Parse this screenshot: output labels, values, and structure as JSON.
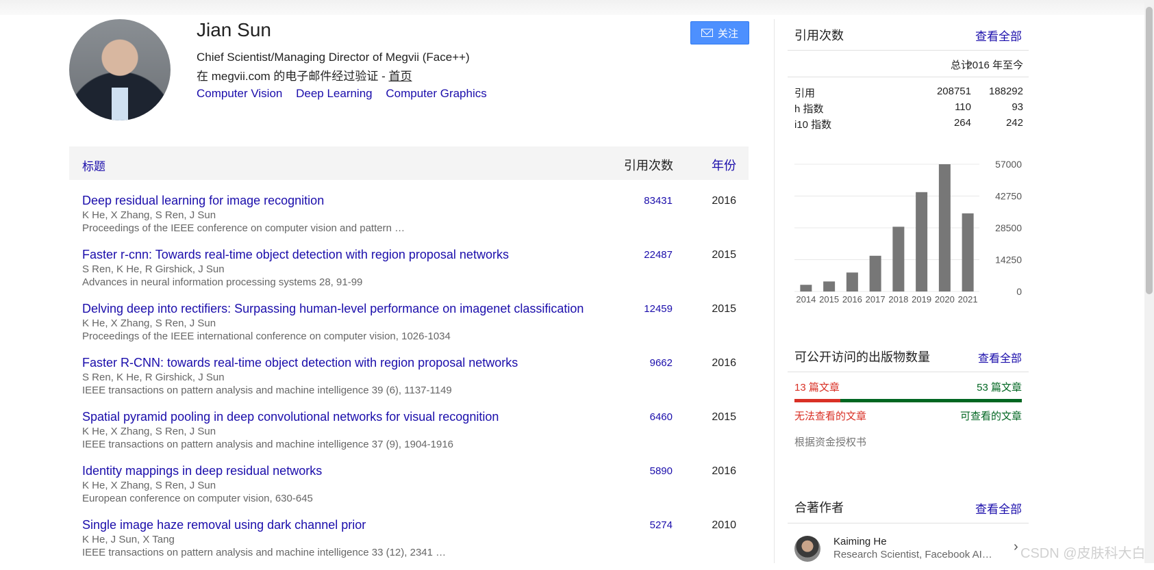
{
  "profile": {
    "name": "Jian Sun",
    "affiliation": "Chief Scientist/Managing Director of Megvii (Face++)",
    "verified_prefix": "在 megvii.com 的电子邮件经过验证 - ",
    "homepage_label": "首页",
    "interests": [
      "Computer Vision",
      "Deep Learning",
      "Computer Graphics"
    ],
    "follow_label": "关注"
  },
  "table": {
    "col_title": "标题",
    "col_cites": "引用次数",
    "col_year": "年份",
    "rows": [
      {
        "title": "Deep residual learning for image recognition",
        "authors": "K He, X Zhang, S Ren, J Sun",
        "venue": "Proceedings of the IEEE conference on computer vision and pattern …",
        "cites": "83431",
        "year": "2016"
      },
      {
        "title": "Faster r-cnn: Towards real-time object detection with region proposal networks",
        "authors": "S Ren, K He, R Girshick, J Sun",
        "venue": "Advances in neural information processing systems 28, 91-99",
        "cites": "22487",
        "year": "2015"
      },
      {
        "title": "Delving deep into rectifiers: Surpassing human-level performance on imagenet classification",
        "authors": "K He, X Zhang, S Ren, J Sun",
        "venue": "Proceedings of the IEEE international conference on computer vision, 1026-1034",
        "cites": "12459",
        "year": "2015"
      },
      {
        "title": "Faster R-CNN: towards real-time object detection with region proposal networks",
        "authors": "S Ren, K He, R Girshick, J Sun",
        "venue": "IEEE transactions on pattern analysis and machine intelligence 39 (6), 1137-1149",
        "cites": "9662",
        "year": "2016"
      },
      {
        "title": "Spatial pyramid pooling in deep convolutional networks for visual recognition",
        "authors": "K He, X Zhang, S Ren, J Sun",
        "venue": "IEEE transactions on pattern analysis and machine intelligence 37 (9), 1904-1916",
        "cites": "6460",
        "year": "2015"
      },
      {
        "title": "Identity mappings in deep residual networks",
        "authors": "K He, X Zhang, S Ren, J Sun",
        "venue": "European conference on computer vision, 630-645",
        "cites": "5890",
        "year": "2016"
      },
      {
        "title": "Single image haze removal using dark channel prior",
        "authors": "K He, J Sun, X Tang",
        "venue": "IEEE transactions on pattern analysis and machine intelligence 33 (12), 2341 …",
        "cites": "5274",
        "year": "2010"
      }
    ]
  },
  "citations": {
    "heading": "引用次数",
    "view_all": "查看全部",
    "col_total": "总计",
    "col_since": "2016 年至今",
    "rows": [
      {
        "label": "引用",
        "total": "208751",
        "since": "188292"
      },
      {
        "label": "h 指数",
        "total": "110",
        "since": "93"
      },
      {
        "label": "i10 指数",
        "total": "264",
        "since": "242"
      }
    ]
  },
  "chart_data": {
    "type": "bar",
    "categories": [
      "2014",
      "2015",
      "2016",
      "2017",
      "2018",
      "2019",
      "2020",
      "2021"
    ],
    "values": [
      3000,
      4500,
      8500,
      16000,
      29000,
      44500,
      57000,
      35000
    ],
    "yticks": [
      "57000",
      "42750",
      "28500",
      "14250",
      "0"
    ],
    "ylim": [
      0,
      57000
    ],
    "bar_color": "#777777"
  },
  "open_access": {
    "heading": "可公开访问的出版物数量",
    "view_all": "查看全部",
    "unavailable_count": "13 篇文章",
    "available_count": "53 篇文章",
    "unavailable_label": "无法查看的文章",
    "available_label": "可查看的文章",
    "mandate_label": "根据资金授权书",
    "unavailable_color": "#d93025",
    "available_color": "#006621"
  },
  "coauthors": {
    "heading": "合著作者",
    "view_all": "查看全部",
    "items": [
      {
        "name": "Kaiming He",
        "affiliation": "Research Scientist, Facebook AI…"
      }
    ]
  },
  "watermark": "CSDN @皮肤科大白"
}
